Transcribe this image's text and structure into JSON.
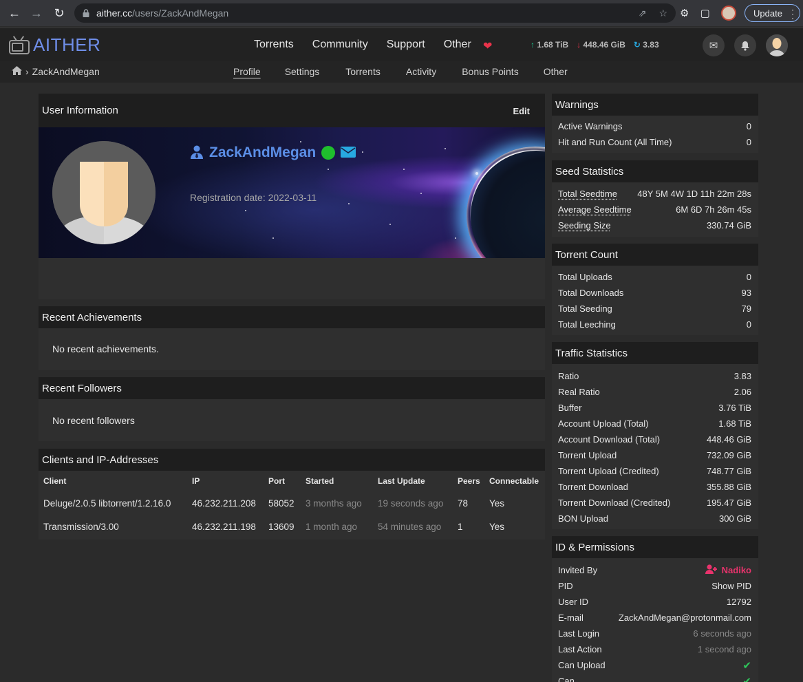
{
  "browser": {
    "url_host": "aither.cc",
    "url_path": "/users/ZackAndMegan",
    "update_label": "Update"
  },
  "header": {
    "logo_text": "AITHER",
    "nav": [
      "Torrents",
      "Community",
      "Support",
      "Other"
    ],
    "upload": "1.68 TiB",
    "download": "448.46 GiB",
    "ratio": "3.83"
  },
  "subnav": {
    "breadcrumb": "ZackAndMegan",
    "links": [
      "Profile",
      "Settings",
      "Torrents",
      "Activity",
      "Bonus Points",
      "Other"
    ]
  },
  "user_info": {
    "title": "User Information",
    "edit_label": "Edit",
    "username": "ZackAndMegan",
    "registration": "Registration date: 2022-03-11"
  },
  "achievements": {
    "title": "Recent Achievements",
    "empty": "No recent achievements."
  },
  "followers": {
    "title": "Recent Followers",
    "empty": "No recent followers"
  },
  "clients": {
    "title": "Clients and IP-Addresses",
    "columns": [
      "Client",
      "IP",
      "Port",
      "Started",
      "Last Update",
      "Peers",
      "Connectable"
    ],
    "rows": [
      [
        "Deluge/2.0.5 libtorrent/1.2.16.0",
        "46.232.211.208",
        "58052",
        "3 months ago",
        "19 seconds ago",
        "78",
        "Yes"
      ],
      [
        "Transmission/3.00",
        "46.232.211.198",
        "13609",
        "1 month ago",
        "54 minutes ago",
        "1",
        "Yes"
      ]
    ]
  },
  "warnings": {
    "title": "Warnings",
    "rows": [
      [
        "Active Warnings",
        "0"
      ],
      [
        "Hit and Run Count (All Time)",
        "0"
      ]
    ]
  },
  "seed_stats": {
    "title": "Seed Statistics",
    "rows": [
      [
        "Total Seedtime",
        "48Y 5M 4W 1D 11h 22m 28s"
      ],
      [
        "Average Seedtime",
        "6M 6D 7h 26m 45s"
      ],
      [
        "Seeding Size",
        "330.74 GiB"
      ]
    ]
  },
  "torrent_count": {
    "title": "Torrent Count",
    "rows": [
      [
        "Total Uploads",
        "0"
      ],
      [
        "Total Downloads",
        "93"
      ],
      [
        "Total Seeding",
        "79"
      ],
      [
        "Total Leeching",
        "0"
      ]
    ]
  },
  "traffic": {
    "title": "Traffic Statistics",
    "rows": [
      [
        "Ratio",
        "3.83"
      ],
      [
        "Real Ratio",
        "2.06"
      ],
      [
        "Buffer",
        "3.76 TiB"
      ],
      [
        "Account Upload (Total)",
        "1.68 TiB"
      ],
      [
        "Account Download (Total)",
        "448.46 GiB"
      ],
      [
        "Torrent Upload",
        "732.09 GiB"
      ],
      [
        "Torrent Upload (Credited)",
        "748.77 GiB"
      ],
      [
        "Torrent Download",
        "355.88 GiB"
      ],
      [
        "Torrent Download (Credited)",
        "195.47 GiB"
      ],
      [
        "BON Upload",
        "300 GiB"
      ]
    ]
  },
  "permissions": {
    "title": "ID & Permissions",
    "invited_by_label": "Invited By",
    "invited_by": "Nadiko",
    "pid_label": "PID",
    "pid_value": "Show PID",
    "user_id_label": "User ID",
    "user_id": "12792",
    "email_label": "E-mail",
    "email": "ZackAndMegan@protonmail.com",
    "last_login_label": "Last Login",
    "last_login": "6 seconds ago",
    "last_action_label": "Last Action",
    "last_action": "1 second ago",
    "can_upload_label": "Can Upload",
    "can_label": "Can"
  },
  "colors": {
    "accent": "#5b8ee6",
    "online": "#1fbf2d",
    "check": "#2ec95b",
    "inviter": "#e8336c"
  }
}
